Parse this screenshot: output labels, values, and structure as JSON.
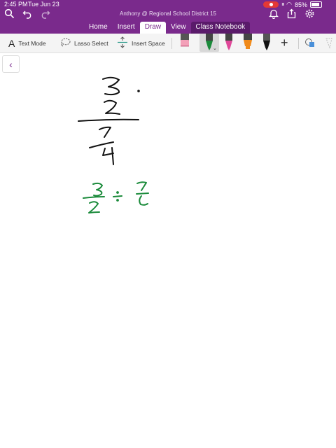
{
  "status_bar": {
    "time": "2:45 PM",
    "date": "Tue Jun 23",
    "battery": "85%",
    "battery_level": 0.85
  },
  "header": {
    "title": "Anthony @ Regional School District 15"
  },
  "tabs": [
    {
      "label": "Home"
    },
    {
      "label": "Insert"
    },
    {
      "label": "Draw"
    },
    {
      "label": "View"
    },
    {
      "label": "Class Notebook"
    }
  ],
  "active_tab": "Draw",
  "toolbar": {
    "text_mode": "Text Mode",
    "lasso_select": "Lasso Select",
    "insert_space": "Insert Space"
  },
  "colors": {
    "brand": "#7a2a8c",
    "ink_black": "#111111",
    "ink_green": "#1a8a3a",
    "pen_pink": "#e0489a",
    "pen_orange": "#f08a1a",
    "eraser_pink": "#f3a0b8"
  },
  "icons": {
    "search": "search-icon",
    "undo": "undo-icon",
    "redo": "redo-icon",
    "bell": "bell-icon",
    "share": "share-icon",
    "settings": "gear-icon",
    "add": "plus-icon",
    "back": "chevron-left-icon"
  }
}
